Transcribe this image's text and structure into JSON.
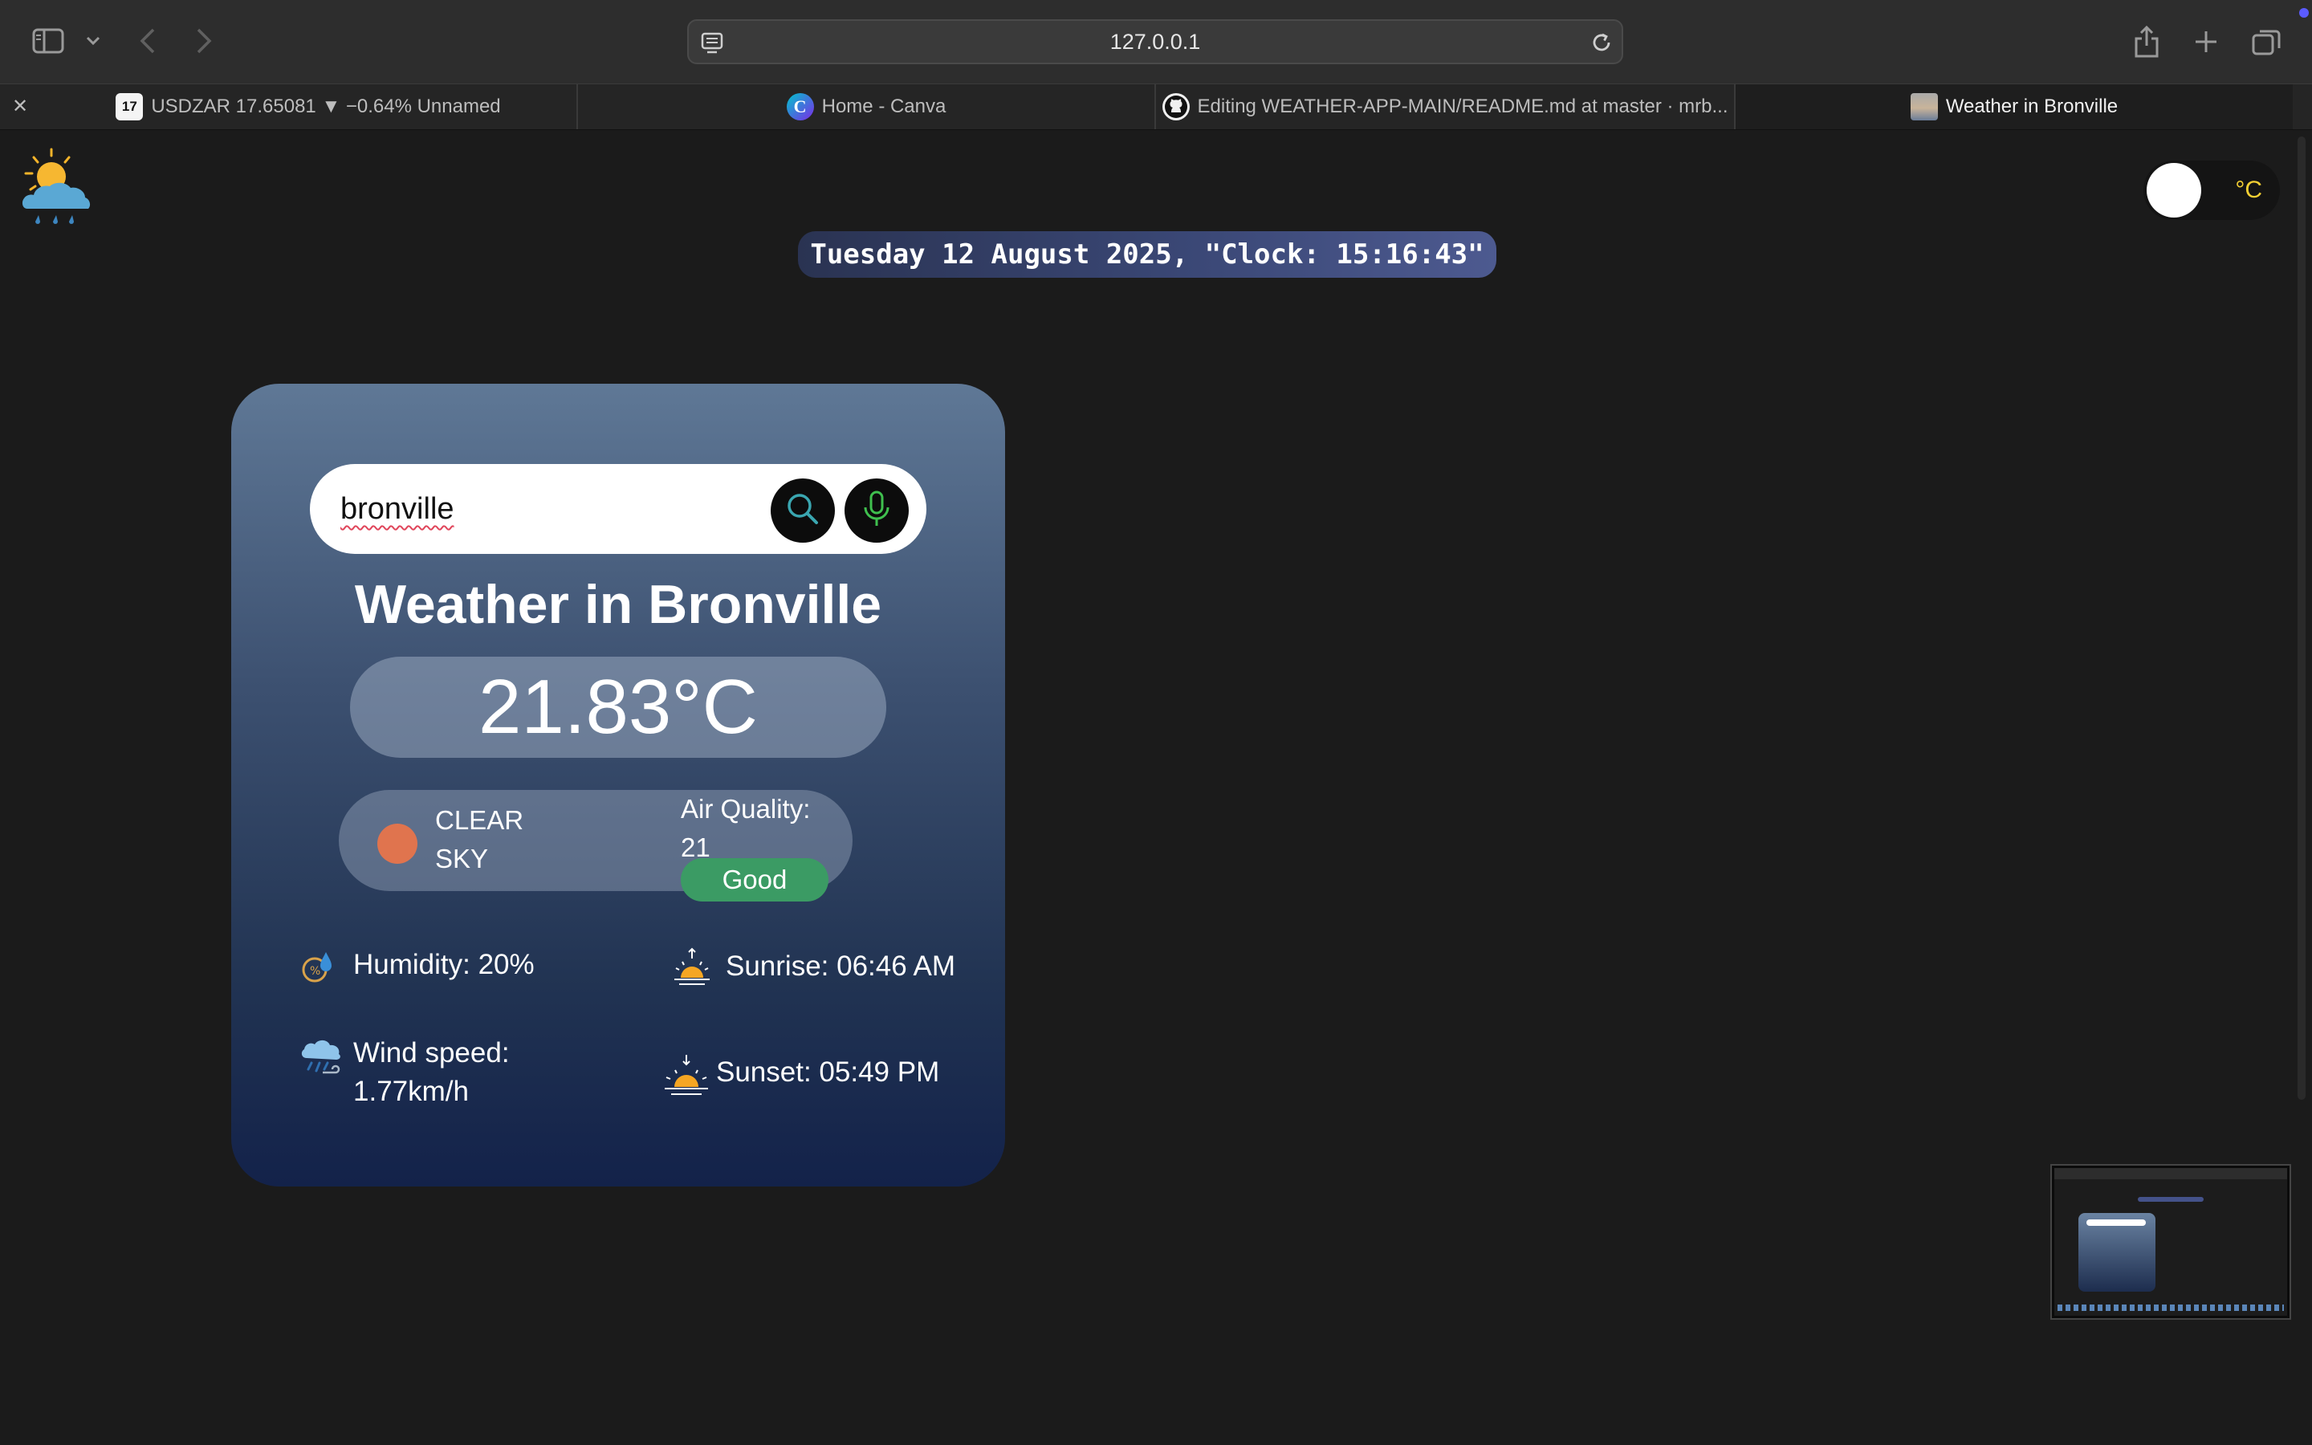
{
  "browser": {
    "url": "127.0.0.1",
    "tabs": [
      {
        "title": "USDZAR 17.65081 ▼ −0.64% Unnamed",
        "favicon": "tradingview-icon",
        "favicon_text": "17",
        "active": false
      },
      {
        "title": "Home - Canva",
        "favicon": "canva-icon",
        "favicon_text": "C",
        "active": false
      },
      {
        "title": "Editing WEATHER-APP-MAIN/README.md at master · mrb...",
        "favicon": "github-icon",
        "active": false
      },
      {
        "title": "Weather in Bronville",
        "favicon": "weather-thumbnail-icon",
        "active": true
      }
    ],
    "icons": [
      "sidebar-icon",
      "chevron-down-icon",
      "back-arrow-icon",
      "forward-arrow-icon",
      "page-settings-icon",
      "reload-icon",
      "share-icon",
      "new-tab-icon",
      "tab-overview-icon",
      "close-icon"
    ]
  },
  "app": {
    "logo_icon": "sun-cloud-rain-icon",
    "unit_toggle": {
      "label": "°C",
      "knob_color": "#ffffff",
      "label_color": "#f5d033"
    },
    "clock": "Tuesday 12 August 2025, \"Clock: 15:16:43\"",
    "search": {
      "value": "bronville",
      "search_icon": "search-icon",
      "mic_icon": "microphone-icon"
    },
    "title": "Weather in Bronville",
    "temperature": "21.83°C",
    "condition": {
      "line1": "CLEAR",
      "line2": "SKY",
      "dot_color": "#e0744e"
    },
    "air_quality": {
      "label": "Air Quality:",
      "value": "21",
      "badge": "Good",
      "badge_color": "#3b9b64"
    },
    "stats": {
      "humidity": {
        "text": "Humidity: 20%",
        "icon": "humidity-icon"
      },
      "wind": {
        "line1": "Wind speed:",
        "line2": "1.77km/h",
        "icon": "wind-cloud-icon"
      },
      "sunrise": {
        "text": "Sunrise: 06:46 AM",
        "icon": "sunrise-icon"
      },
      "sunset": {
        "text": "Sunset: 05:49 PM",
        "icon": "sunset-icon"
      }
    }
  },
  "colors": {
    "page_bg": "#1b1b1b",
    "card_top": "#5f7896",
    "card_bottom": "#13224a",
    "clock_bg": "#3a4775"
  }
}
